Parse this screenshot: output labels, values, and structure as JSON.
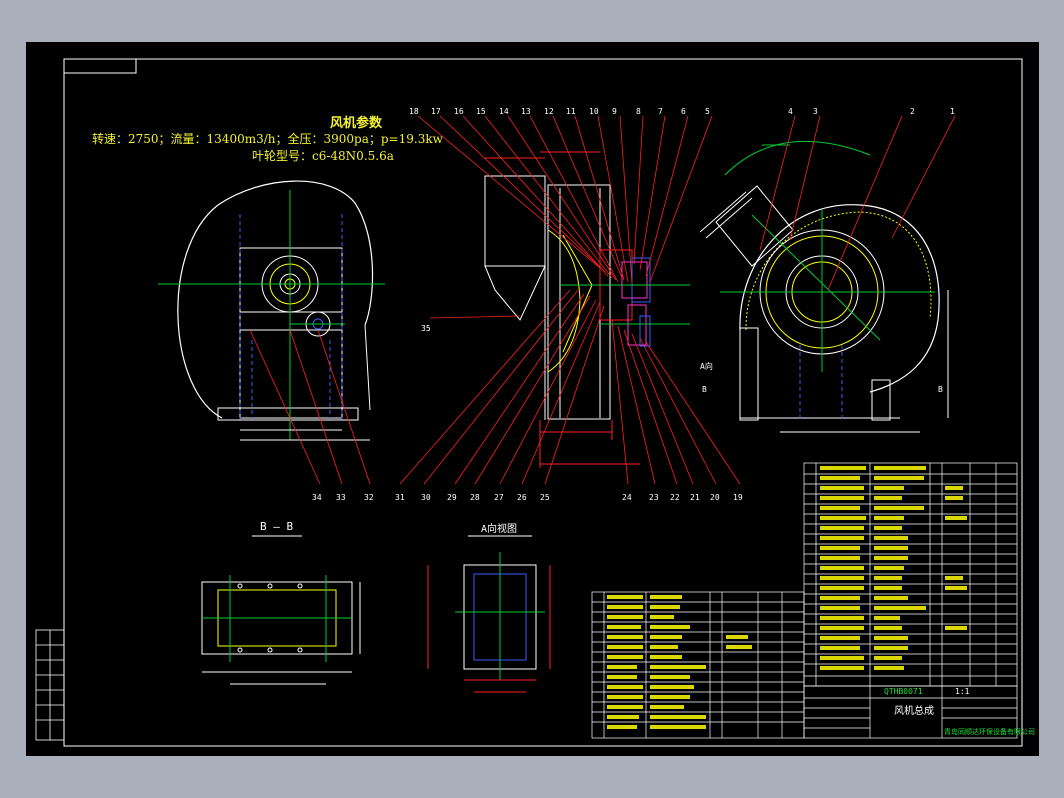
{
  "params": {
    "heading": "风机参数",
    "line1": "转速：2750；流量：13400m3/h；全压：3900pa；p=19.3kw",
    "line2": "叶轮型号：c6-48N0.5.6a"
  },
  "views": {
    "section_bb": "B — B",
    "view_a": "A向视图"
  },
  "leaders_top": [
    "18",
    "17",
    "16",
    "15",
    "14",
    "13",
    "12",
    "11",
    "10",
    "9",
    "8",
    "7",
    "6",
    "5",
    "4",
    "3",
    "2",
    "1"
  ],
  "leaders_bottom": [
    "34",
    "33",
    "32",
    "31",
    "30",
    "29",
    "28",
    "27",
    "26",
    "25",
    "24",
    "23",
    "22",
    "21",
    "20",
    "19"
  ],
  "leader_35": "35",
  "view_labels": {
    "a_left": "A向",
    "b_left": "B",
    "b_right": "B"
  },
  "title_block": {
    "drawing_title": "风机总成",
    "drawing_code": "QTHB0071",
    "scale": "1:1",
    "company": "青岛同顺达环保设备有限公司"
  },
  "colors": {
    "frame": "#ffffff",
    "outline": "#ffff00",
    "centerline": "#00cc33",
    "leader": "#ff2020",
    "hidden": "#3a5cff",
    "magenta": "#ff33cc"
  }
}
